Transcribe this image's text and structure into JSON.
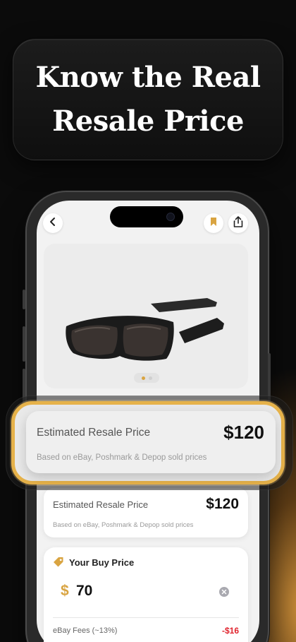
{
  "headline": {
    "line1": "Know the Real",
    "line2": "Resale Price"
  },
  "icons": {
    "back": "chevron-left-icon",
    "bookmark": "bookmark-icon",
    "share": "share-icon",
    "tag": "tag-icon",
    "clear": "clear-x-icon"
  },
  "carousel": {
    "total": 2,
    "active": 1
  },
  "highlight": {
    "label": "Estimated Resale Price",
    "price": "$120",
    "note": "Based on eBay, Poshmark & Depop sold prices"
  },
  "resale_card": {
    "label": "Estimated Resale Price",
    "price": "$120",
    "note": "Based on eBay, Poshmark & Depop sold prices"
  },
  "buy_price": {
    "title": "Your Buy Price",
    "currency": "$",
    "amount": "70",
    "fee_label": "eBay Fees (~13%)",
    "fee_value": "-$16"
  },
  "colors": {
    "accent": "#E6B24A",
    "fee_negative": "#E0242E",
    "background": "#0B0B0B"
  }
}
